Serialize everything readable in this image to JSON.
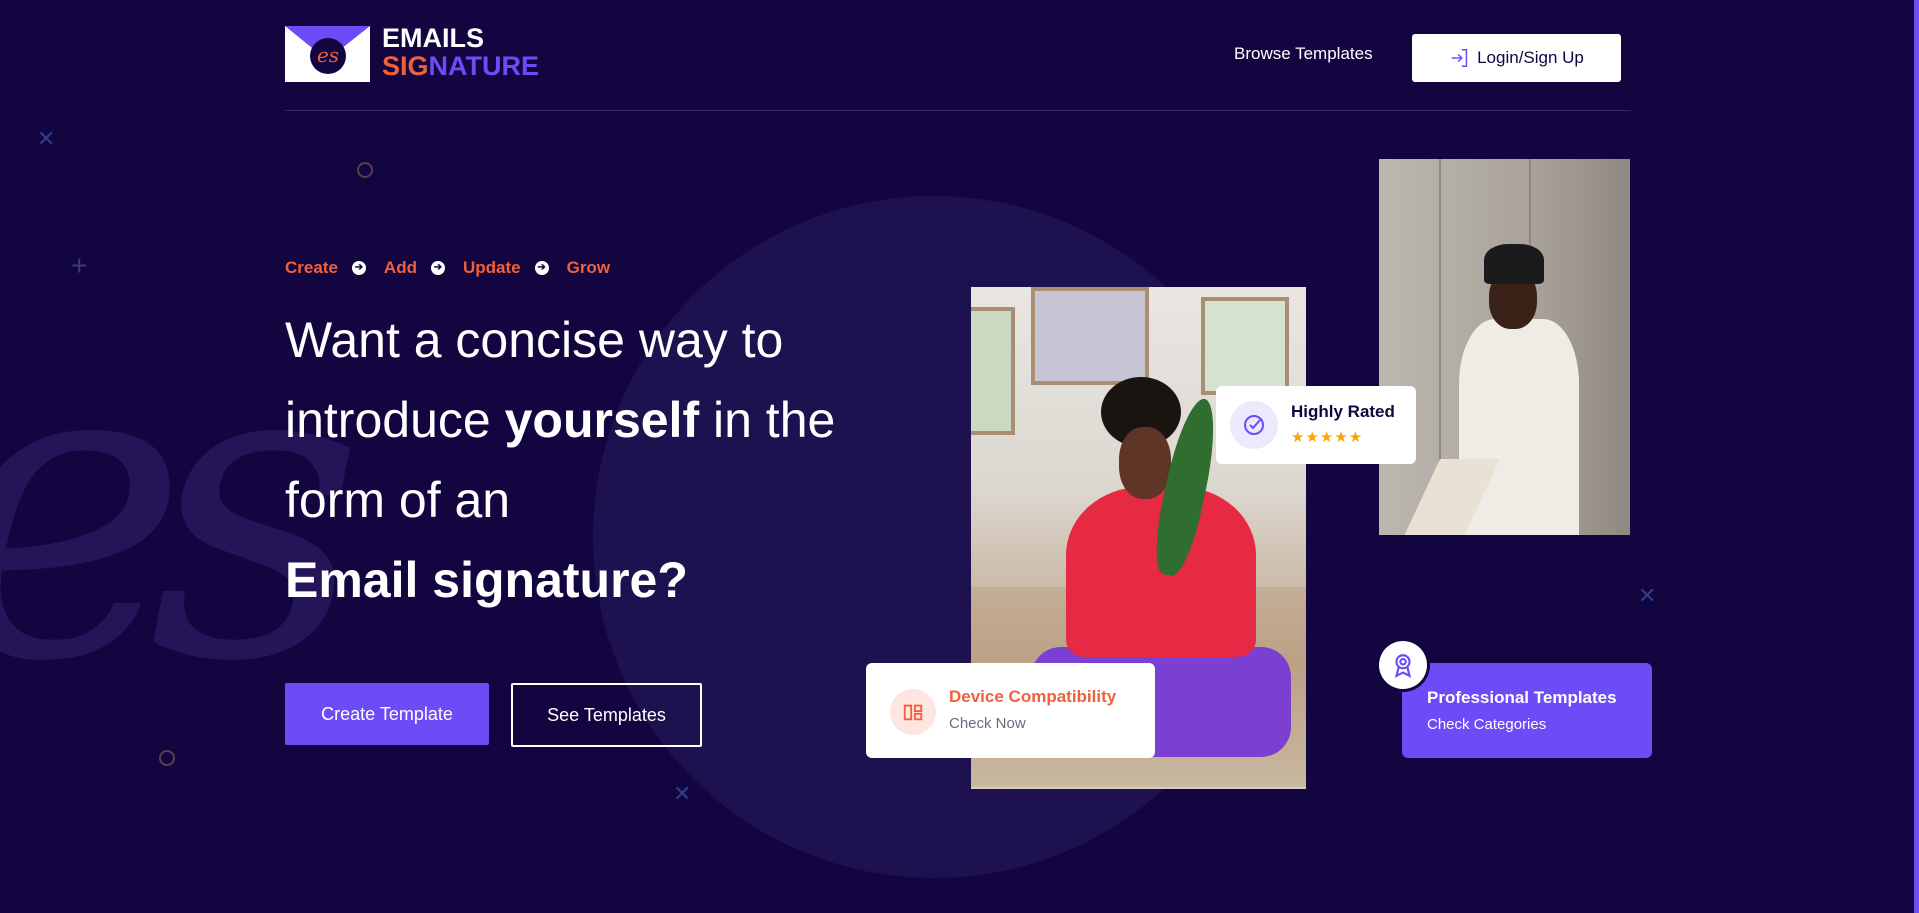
{
  "brand": {
    "line1": "EMAILS",
    "line2_part1": "SIG",
    "line2_part2": "NATURE",
    "monogram": "es"
  },
  "nav": {
    "browse": "Browse Templates",
    "login": "Login/Sign Up"
  },
  "hero": {
    "steps": [
      "Create",
      "Add",
      "Update",
      "Grow"
    ],
    "headline": {
      "l1": "Want a concise way to",
      "l2_pre": "introduce ",
      "l2_bold": "yourself",
      "l2_post": " in the",
      "l3": "form of an",
      "l4": "Email signature?"
    },
    "cta_primary": "Create Template",
    "cta_secondary": "See Templates"
  },
  "cards": {
    "rated": {
      "title": "Highly Rated",
      "stars": "★★★★★",
      "rating": 5
    },
    "device": {
      "title": "Device Compatibility",
      "sub": "Check Now"
    },
    "pro": {
      "title": "Professional Templates",
      "sub": "Check Categories"
    }
  },
  "colors": {
    "background": "#130640",
    "accent_purple": "#6b4cf6",
    "accent_orange": "#f2603a",
    "star": "#f5a70a"
  },
  "icons": {
    "login": "login-door-icon",
    "rated": "check-badge-icon",
    "device": "layout-icon",
    "pro": "award-ribbon-icon"
  }
}
